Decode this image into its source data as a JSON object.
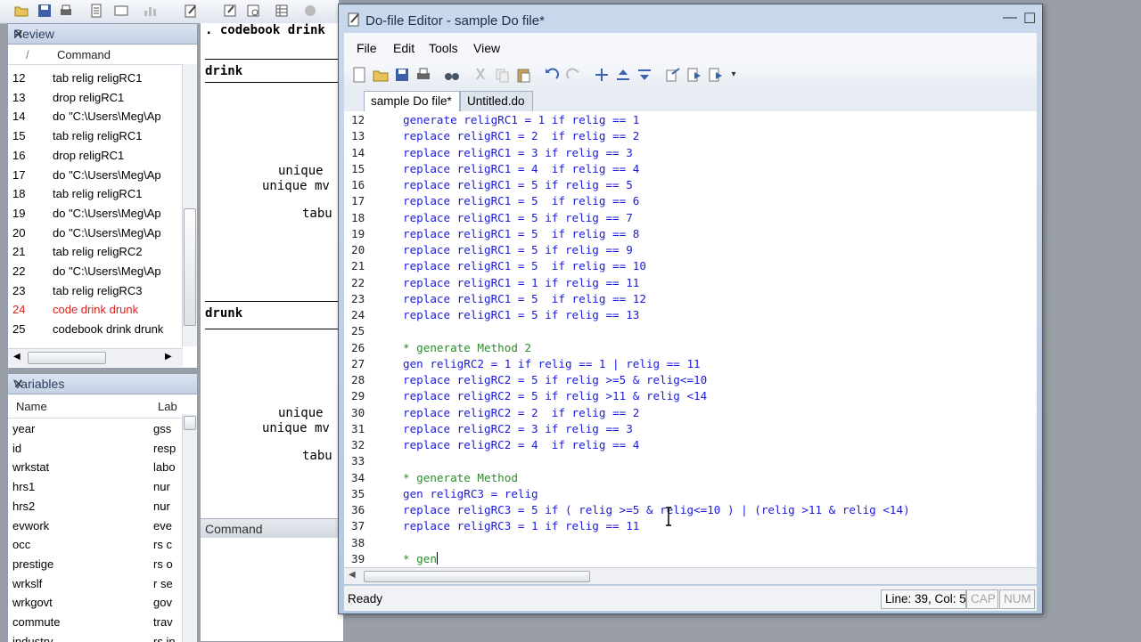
{
  "review": {
    "title": "Review",
    "col_num": "/",
    "col_command": "Command",
    "rows": [
      {
        "n": "12",
        "cmd": "tab relig religRC1",
        "error": false
      },
      {
        "n": "13",
        "cmd": "drop religRC1",
        "error": false
      },
      {
        "n": "14",
        "cmd": "do \"C:\\Users\\Meg\\Ap",
        "error": false
      },
      {
        "n": "15",
        "cmd": "tab relig religRC1",
        "error": false
      },
      {
        "n": "16",
        "cmd": "drop religRC1",
        "error": false
      },
      {
        "n": "17",
        "cmd": "do \"C:\\Users\\Meg\\Ap",
        "error": false
      },
      {
        "n": "18",
        "cmd": "tab relig religRC1",
        "error": false
      },
      {
        "n": "19",
        "cmd": "do \"C:\\Users\\Meg\\Ap",
        "error": false
      },
      {
        "n": "20",
        "cmd": "do \"C:\\Users\\Meg\\Ap",
        "error": false
      },
      {
        "n": "21",
        "cmd": "tab relig religRC2",
        "error": false
      },
      {
        "n": "22",
        "cmd": "do \"C:\\Users\\Meg\\Ap",
        "error": false
      },
      {
        "n": "23",
        "cmd": "tab relig religRC3",
        "error": false
      },
      {
        "n": "24",
        "cmd": "code drink drunk",
        "error": true
      },
      {
        "n": "25",
        "cmd": "codebook drink drunk",
        "error": false
      }
    ]
  },
  "variables": {
    "title": "Variables",
    "col_name": "Name",
    "col_label": "Lab",
    "rows": [
      {
        "name": "year",
        "label": "gss"
      },
      {
        "name": "id",
        "label": "resp"
      },
      {
        "name": "wrkstat",
        "label": "labo"
      },
      {
        "name": "hrs1",
        "label": "nur"
      },
      {
        "name": "hrs2",
        "label": "nur"
      },
      {
        "name": "evwork",
        "label": "eve"
      },
      {
        "name": "occ",
        "label": "rs c"
      },
      {
        "name": "prestige",
        "label": "rs o"
      },
      {
        "name": "wrkslf",
        "label": "r se"
      },
      {
        "name": "wrkgovt",
        "label": "gov"
      },
      {
        "name": "commute",
        "label": "trav"
      },
      {
        "name": "industry",
        "label": "rs in"
      }
    ]
  },
  "results": {
    "cmd_line": ". codebook drink",
    "var1": "drink",
    "var2": "drunk",
    "unique": "unique",
    "unique_mv": "unique mv",
    "tabu": "tabu"
  },
  "command_window": {
    "title": "Command"
  },
  "editor": {
    "title": "Do-file Editor - sample Do file*",
    "menu": [
      "File",
      "Edit",
      "Tools",
      "View"
    ],
    "tabs": [
      "sample Do file*",
      "Untitled.do"
    ],
    "lines": [
      {
        "n": "12",
        "code": "generate religRC1 = 1 if relig == 1",
        "comment": false
      },
      {
        "n": "13",
        "code": "replace religRC1 = 2  if relig == 2",
        "comment": false
      },
      {
        "n": "14",
        "code": "replace religRC1 = 3 if relig == 3",
        "comment": false
      },
      {
        "n": "15",
        "code": "replace religRC1 = 4  if relig == 4",
        "comment": false
      },
      {
        "n": "16",
        "code": "replace religRC1 = 5 if relig == 5",
        "comment": false
      },
      {
        "n": "17",
        "code": "replace religRC1 = 5  if relig == 6",
        "comment": false
      },
      {
        "n": "18",
        "code": "replace religRC1 = 5 if relig == 7",
        "comment": false
      },
      {
        "n": "19",
        "code": "replace religRC1 = 5  if relig == 8",
        "comment": false
      },
      {
        "n": "20",
        "code": "replace religRC1 = 5 if relig == 9",
        "comment": false
      },
      {
        "n": "21",
        "code": "replace religRC1 = 5  if relig == 10",
        "comment": false
      },
      {
        "n": "22",
        "code": "replace religRC1 = 1 if relig == 11",
        "comment": false
      },
      {
        "n": "23",
        "code": "replace religRC1 = 5  if relig == 12",
        "comment": false
      },
      {
        "n": "24",
        "code": "replace religRC1 = 5 if relig == 13",
        "comment": false
      },
      {
        "n": "25",
        "code": "",
        "comment": false
      },
      {
        "n": "26",
        "code": "* generate Method 2",
        "comment": true
      },
      {
        "n": "27",
        "code": "gen religRC2 = 1 if relig == 1 | relig == 11",
        "comment": false
      },
      {
        "n": "28",
        "code": "replace religRC2 = 5 if relig >=5 & relig<=10",
        "comment": false
      },
      {
        "n": "29",
        "code": "replace religRC2 = 5 if relig >11 & relig <14",
        "comment": false
      },
      {
        "n": "30",
        "code": "replace religRC2 = 2  if relig == 2",
        "comment": false
      },
      {
        "n": "31",
        "code": "replace religRC2 = 3 if relig == 3",
        "comment": false
      },
      {
        "n": "32",
        "code": "replace religRC2 = 4  if relig == 4",
        "comment": false
      },
      {
        "n": "33",
        "code": "",
        "comment": false
      },
      {
        "n": "34",
        "code": "* generate Method",
        "comment": true
      },
      {
        "n": "35",
        "code": "gen religRC3 = relig",
        "comment": false
      },
      {
        "n": "36",
        "code": "replace religRC3 = 5 if ( relig >=5 & relig<=10 ) | (relig >11 & relig <14)",
        "comment": false
      },
      {
        "n": "37",
        "code": "replace religRC3 = 1 if relig == 11",
        "comment": false
      },
      {
        "n": "38",
        "code": "",
        "comment": false
      },
      {
        "n": "39",
        "code": "* gen",
        "comment": true
      }
    ],
    "status_ready": "Ready",
    "status_pos": "Line: 39, Col: 5",
    "status_cap": "CAP",
    "status_num": "NUM"
  }
}
